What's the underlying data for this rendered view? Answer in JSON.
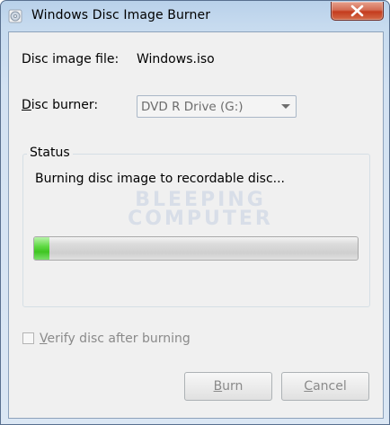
{
  "window": {
    "title": "Windows Disc Image Burner"
  },
  "form": {
    "image_label": "Disc image file:",
    "image_value": "Windows.iso",
    "burner_label": "Disc burner:",
    "burner_value": "DVD R Drive (G:)"
  },
  "status": {
    "group_title": "Status",
    "message": "Burning disc image to recordable disc...",
    "progress_fraction": 0.047
  },
  "watermark": {
    "line1": "BLEEPING",
    "line2": "COMPUTER"
  },
  "options": {
    "verify_label": "Verify disc after burning",
    "verify_checked": false
  },
  "buttons": {
    "burn_label": "Burn",
    "cancel_label": "Cancel"
  },
  "icons": {
    "app": "disc-burner-icon",
    "close": "close-icon",
    "combo": "chevron-down-icon"
  }
}
